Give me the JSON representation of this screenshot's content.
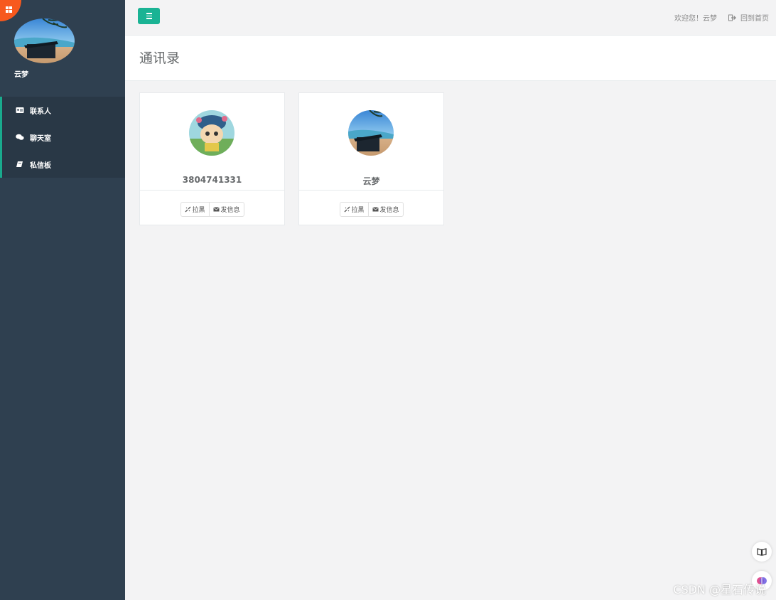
{
  "sidebar": {
    "profile_name": "云梦",
    "items": [
      {
        "label": "联系人",
        "icon": "id-card-icon"
      },
      {
        "label": "聊天室",
        "icon": "chat-bubbles-icon"
      },
      {
        "label": "私信板",
        "icon": "book-icon"
      }
    ]
  },
  "topbar": {
    "welcome": "欢迎您！云梦",
    "home_link": "回到首页"
  },
  "page": {
    "title": "通讯录"
  },
  "contacts": [
    {
      "name": "3804741331",
      "block_label": "拉黑",
      "message_label": "发信息"
    },
    {
      "name": "云梦",
      "block_label": "拉黑",
      "message_label": "发信息"
    }
  ],
  "watermark": "CSDN @星石传说",
  "colors": {
    "sidebar": "#2f4050",
    "accent": "#1ab394",
    "badge": "#f7591e"
  }
}
